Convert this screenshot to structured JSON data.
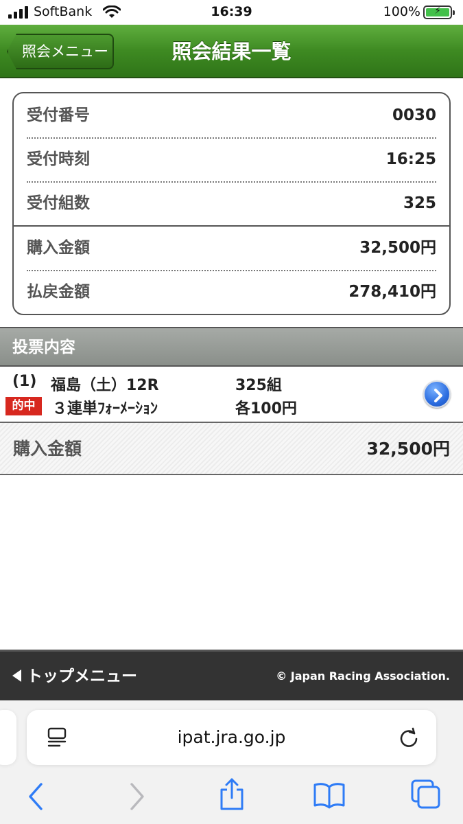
{
  "status_bar": {
    "carrier": "SoftBank",
    "time": "16:39",
    "battery": "100%"
  },
  "header": {
    "back_label": "照会メニュー",
    "title": "照会結果一覧"
  },
  "summary": {
    "rows": [
      {
        "label": "受付番号",
        "value": "0030"
      },
      {
        "label": "受付時刻",
        "value": "16:25"
      },
      {
        "label": "受付組数",
        "value": "325"
      },
      {
        "label": "購入金額",
        "value": "32,500円"
      },
      {
        "label": "払戻金額",
        "value": "278,410円"
      }
    ]
  },
  "votes": {
    "section_title": "投票内容",
    "items": [
      {
        "index": "(1)",
        "race": "福島（土）12R",
        "count": "325組",
        "hit_badge": "的中",
        "bet_type": "３連単ﾌｫｰﾒｰｼｮﾝ",
        "unit_amount": "各100円"
      }
    ],
    "total_label": "購入金額",
    "total_value": "32,500円"
  },
  "footer": {
    "top_menu_label": "トップメニュー",
    "copyright": "© Japan Racing Association."
  },
  "browser": {
    "url": "ipat.jra.go.jp"
  },
  "colors": {
    "header_green": "#3e8a22",
    "hit_red": "#d7281f",
    "footer_dark": "#333333",
    "safari_blue": "#2f7cf6"
  }
}
